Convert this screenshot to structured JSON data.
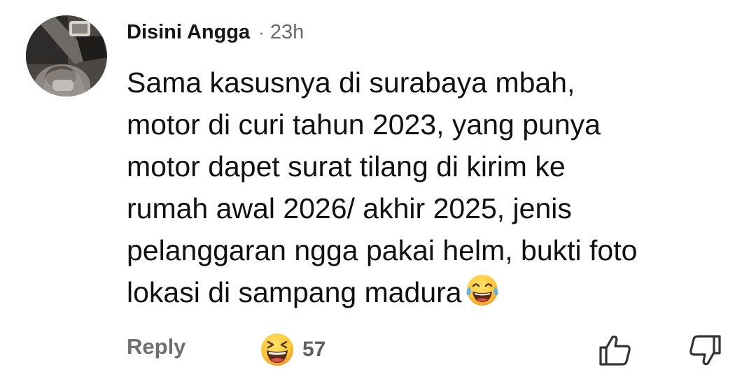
{
  "comment": {
    "author": "Disini Angga",
    "separator": "·",
    "timestamp": "23h",
    "text_lines": [
      "Sama kasusnya di surabaya mbah,",
      "motor di curi tahun 2023, yang punya",
      "motor dapet surat tilang di kirim ke",
      "rumah awal 2026/ akhir 2025, jenis",
      "pelanggaran ngga pakai helm, bukti foto",
      "lokasi di sampang madura"
    ],
    "inline_emoji": "face-with-tears-of-joy"
  },
  "actions": {
    "reply_label": "Reply",
    "reaction_emoji": "grinning-squinting-face",
    "reaction_count": "57",
    "like_icon": "thumbs-up-outline-icon",
    "dislike_icon": "thumbs-down-outline-icon"
  },
  "colors": {
    "text": "#111111",
    "muted": "#6b6b6b",
    "emoji_yellow": "#ffcc33",
    "emoji_orange": "#f59a23",
    "tear_blue": "#5db3f0",
    "mouth_red": "#c8202a"
  }
}
